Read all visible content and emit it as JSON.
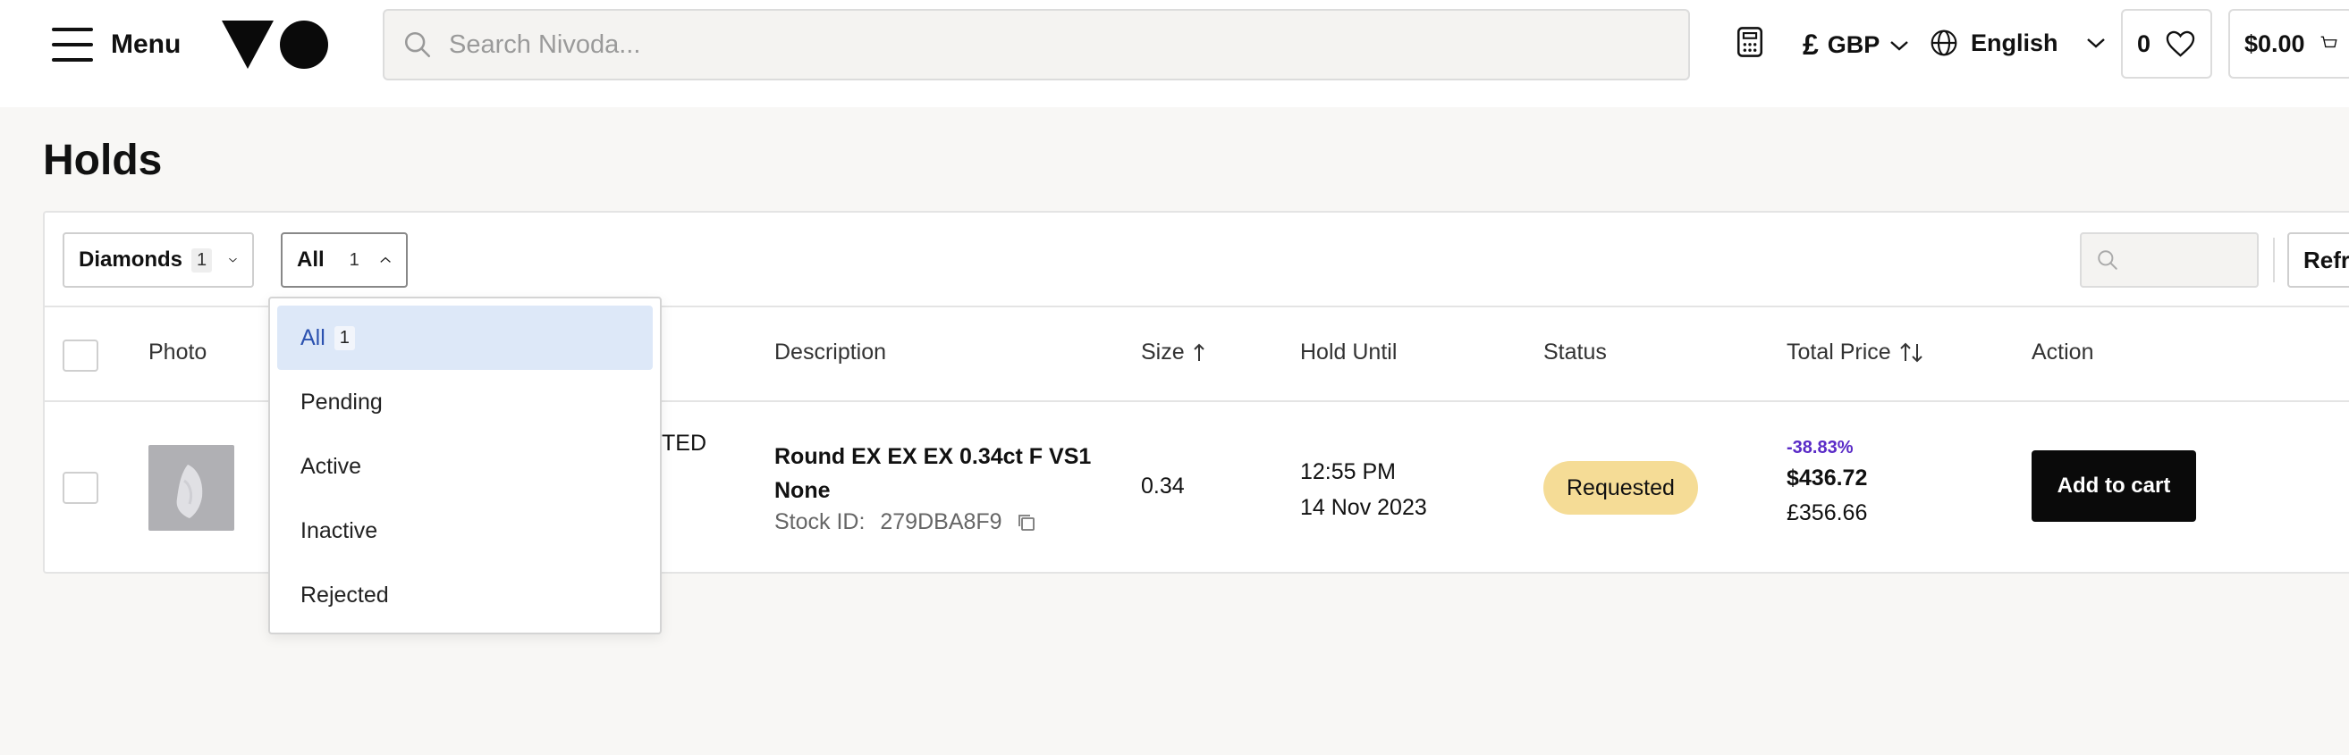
{
  "header": {
    "menu_label": "Menu",
    "search_placeholder": "Search Nivoda...",
    "currency_symbol": "£",
    "currency": "GBP",
    "language": "English",
    "wishlist_count": "0",
    "cart_total": "$0.00"
  },
  "page": {
    "title": "Holds"
  },
  "filters": {
    "category_label": "Diamonds",
    "category_count": "1",
    "status_label": "All",
    "status_count": "1",
    "refresh_label": "Refre"
  },
  "dropdown": {
    "items": [
      {
        "label": "All",
        "count": "1",
        "selected": true
      },
      {
        "label": "Pending"
      },
      {
        "label": "Active"
      },
      {
        "label": "Inactive"
      },
      {
        "label": "Rejected"
      }
    ]
  },
  "table": {
    "headers": {
      "photo": "Photo",
      "description": "Description",
      "size": "Size",
      "hold_until": "Hold Until",
      "status": "Status",
      "total_price": "Total Price",
      "action": "Action"
    },
    "rows": [
      {
        "partial_text": "TED",
        "description_line1": "Round EX EX EX 0.34ct F VS1",
        "description_line2": "None",
        "stock_label": "Stock ID:",
        "stock_id": "279DBA8F9",
        "size": "0.34",
        "hold_time": "12:55 PM",
        "hold_date": "14 Nov 2023",
        "status": "Requested",
        "discount": "-38.83%",
        "price_usd": "$436.72",
        "price_gbp": "£356.66",
        "action_label": "Add to cart"
      }
    ]
  },
  "colors": {
    "accent_purple": "#5a2bc7",
    "status_badge": "#f5dc96",
    "selected_item_bg": "#dde8f8",
    "cart_button": "#0a0a0a"
  }
}
